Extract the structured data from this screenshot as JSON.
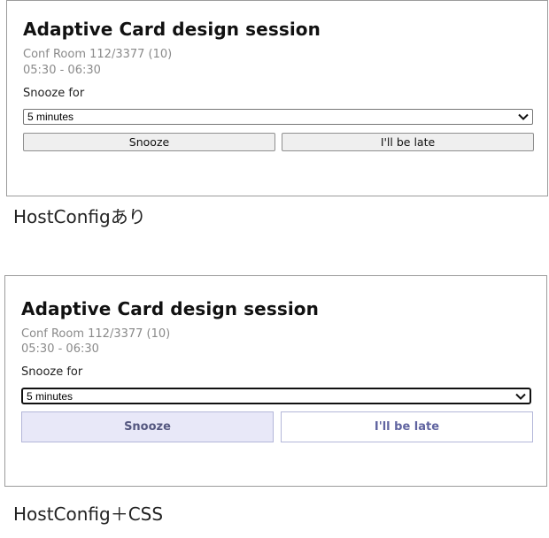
{
  "cards": [
    {
      "title": "Adaptive Card design session",
      "room": "Conf Room 112/3377 (10)",
      "time": "05:30 - 06:30",
      "snooze_label": "Snooze for",
      "select_value": "5 minutes",
      "snooze_button": "Snooze",
      "late_button": "I'll be late"
    },
    {
      "title": "Adaptive Card design session",
      "room": "Conf Room 112/3377 (10)",
      "time": "05:30 - 06:30",
      "snooze_label": "Snooze for",
      "select_value": "5 minutes",
      "snooze_button": "Snooze",
      "late_button": "I'll be late"
    }
  ],
  "captions": {
    "first": "HostConfigあり",
    "second": "HostConfig＋CSS"
  },
  "colors": {
    "card_border": "#9b9b9b",
    "button_default_bg": "#efefef",
    "button_styled_bg": "#e8e8f8",
    "button_styled_border": "#b3b6d9",
    "button_styled_text": "#5b5c8f",
    "muted_text": "#8a8a8a"
  },
  "icons": [
    "chevron-down-icon"
  ]
}
